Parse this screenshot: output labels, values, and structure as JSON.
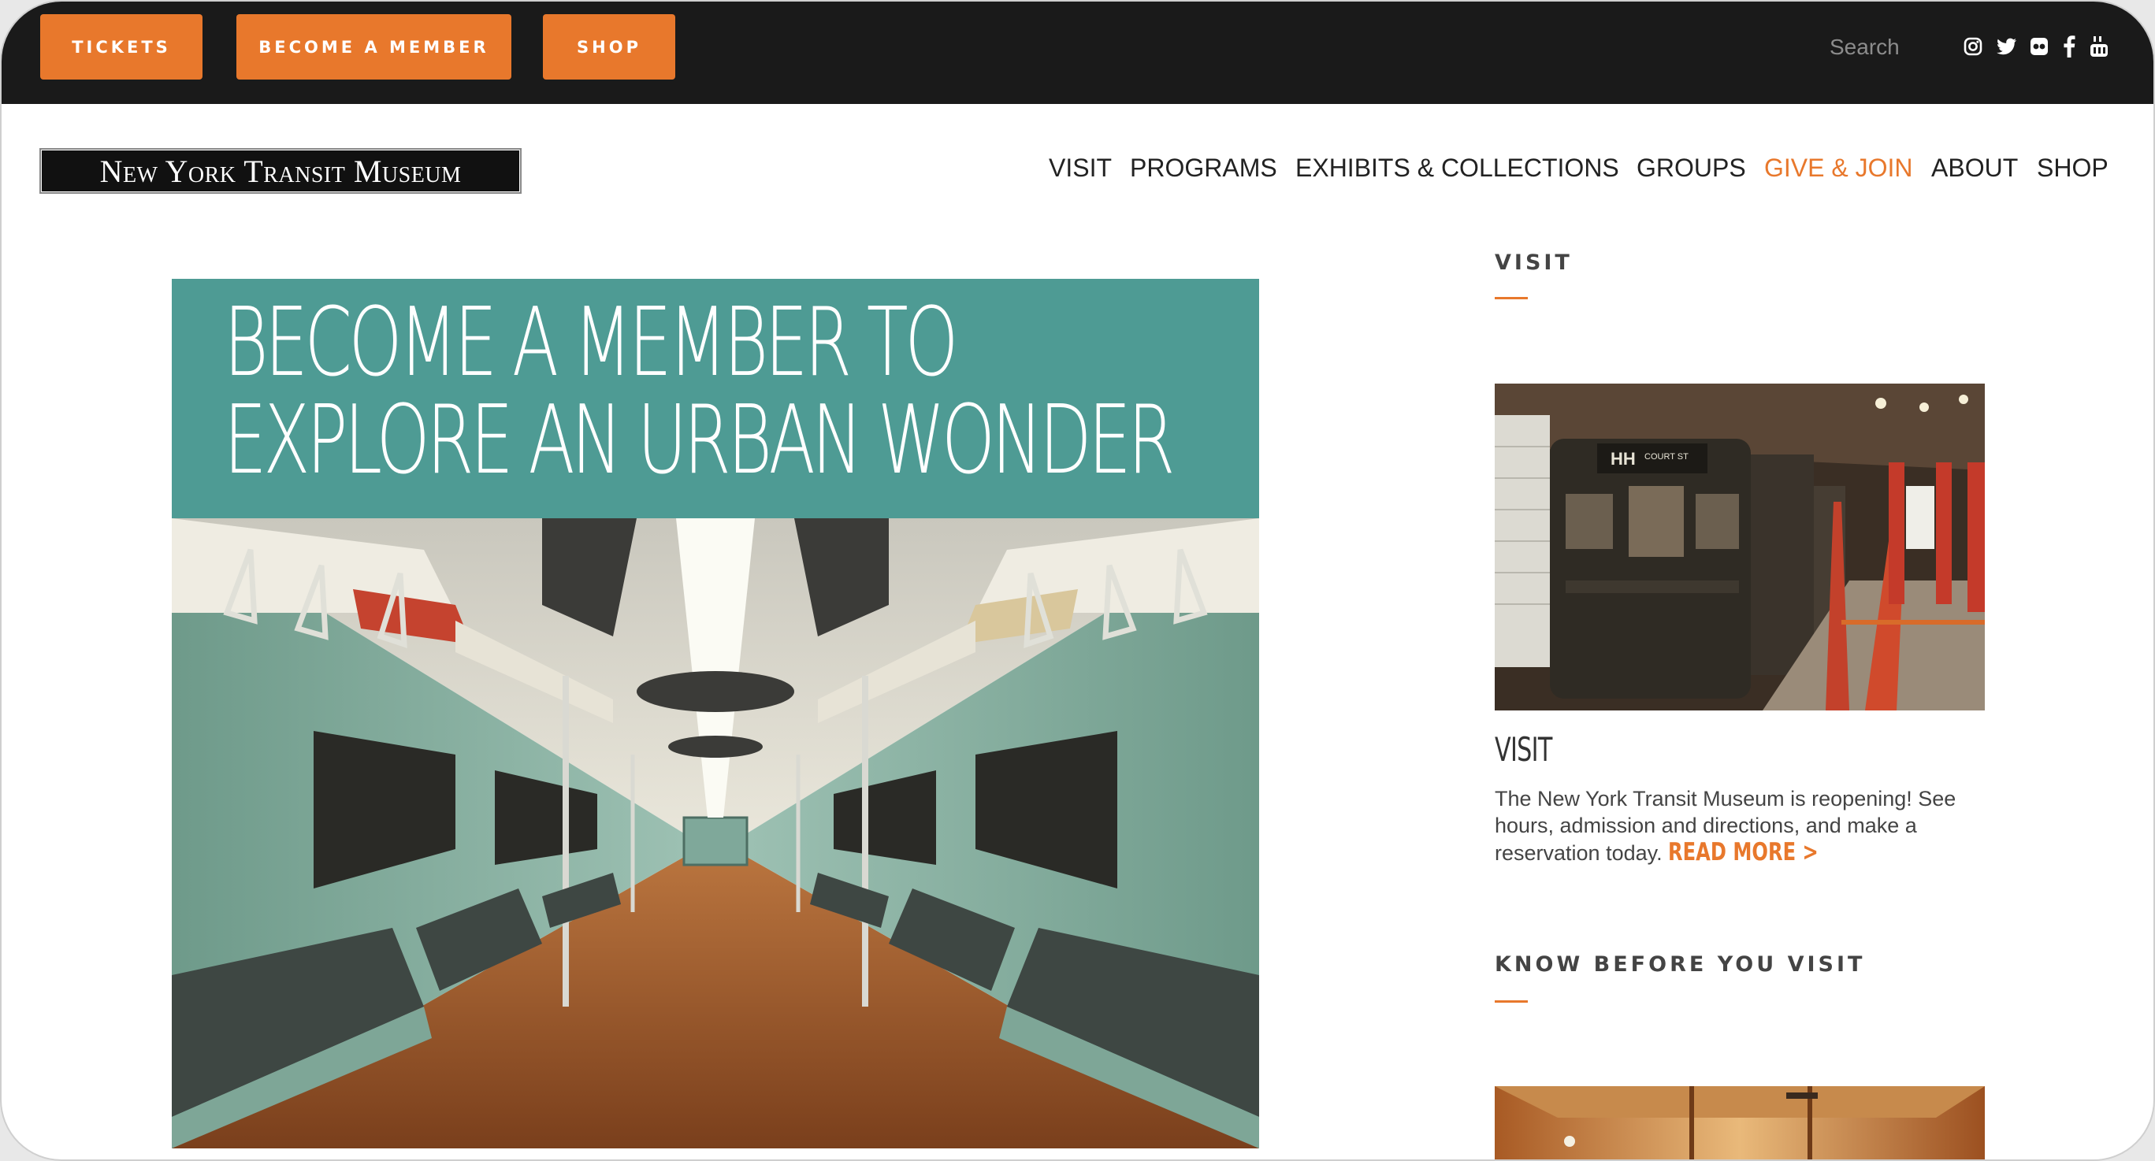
{
  "topbar": {
    "buttons": [
      "TICKETS",
      "BECOME A MEMBER",
      "SHOP"
    ],
    "search_placeholder": "Search",
    "social_icons": [
      "instagram-icon",
      "twitter-icon",
      "flickr-icon",
      "facebook-icon",
      "youtube-icon"
    ]
  },
  "header": {
    "logo_text": "New York Transit Museum",
    "nav": [
      "VISIT",
      "PROGRAMS",
      "EXHIBITS & COLLECTIONS",
      "GROUPS",
      "GIVE & JOIN",
      "ABOUT",
      "SHOP"
    ],
    "active_nav": "GIVE & JOIN"
  },
  "hero": {
    "headline_line1": "BECOME A MEMBER TO",
    "headline_line2": "EXPLORE AN URBAN WONDER"
  },
  "sidebar": {
    "section1_heading": "VISIT",
    "card_title": "VISIT",
    "card_text": "The New York Transit Museum is reopening! See hours, admission and directions, and make a reservation today.",
    "read_more": "READ MORE >",
    "section2_heading": "KNOW BEFORE YOU VISIT",
    "train_sign": "HH",
    "train_sign_small": "COURT ST"
  },
  "colors": {
    "accent": "#e8782c",
    "topbar_bg": "#1a1a1a",
    "hero_banner": "#4e9b94"
  }
}
